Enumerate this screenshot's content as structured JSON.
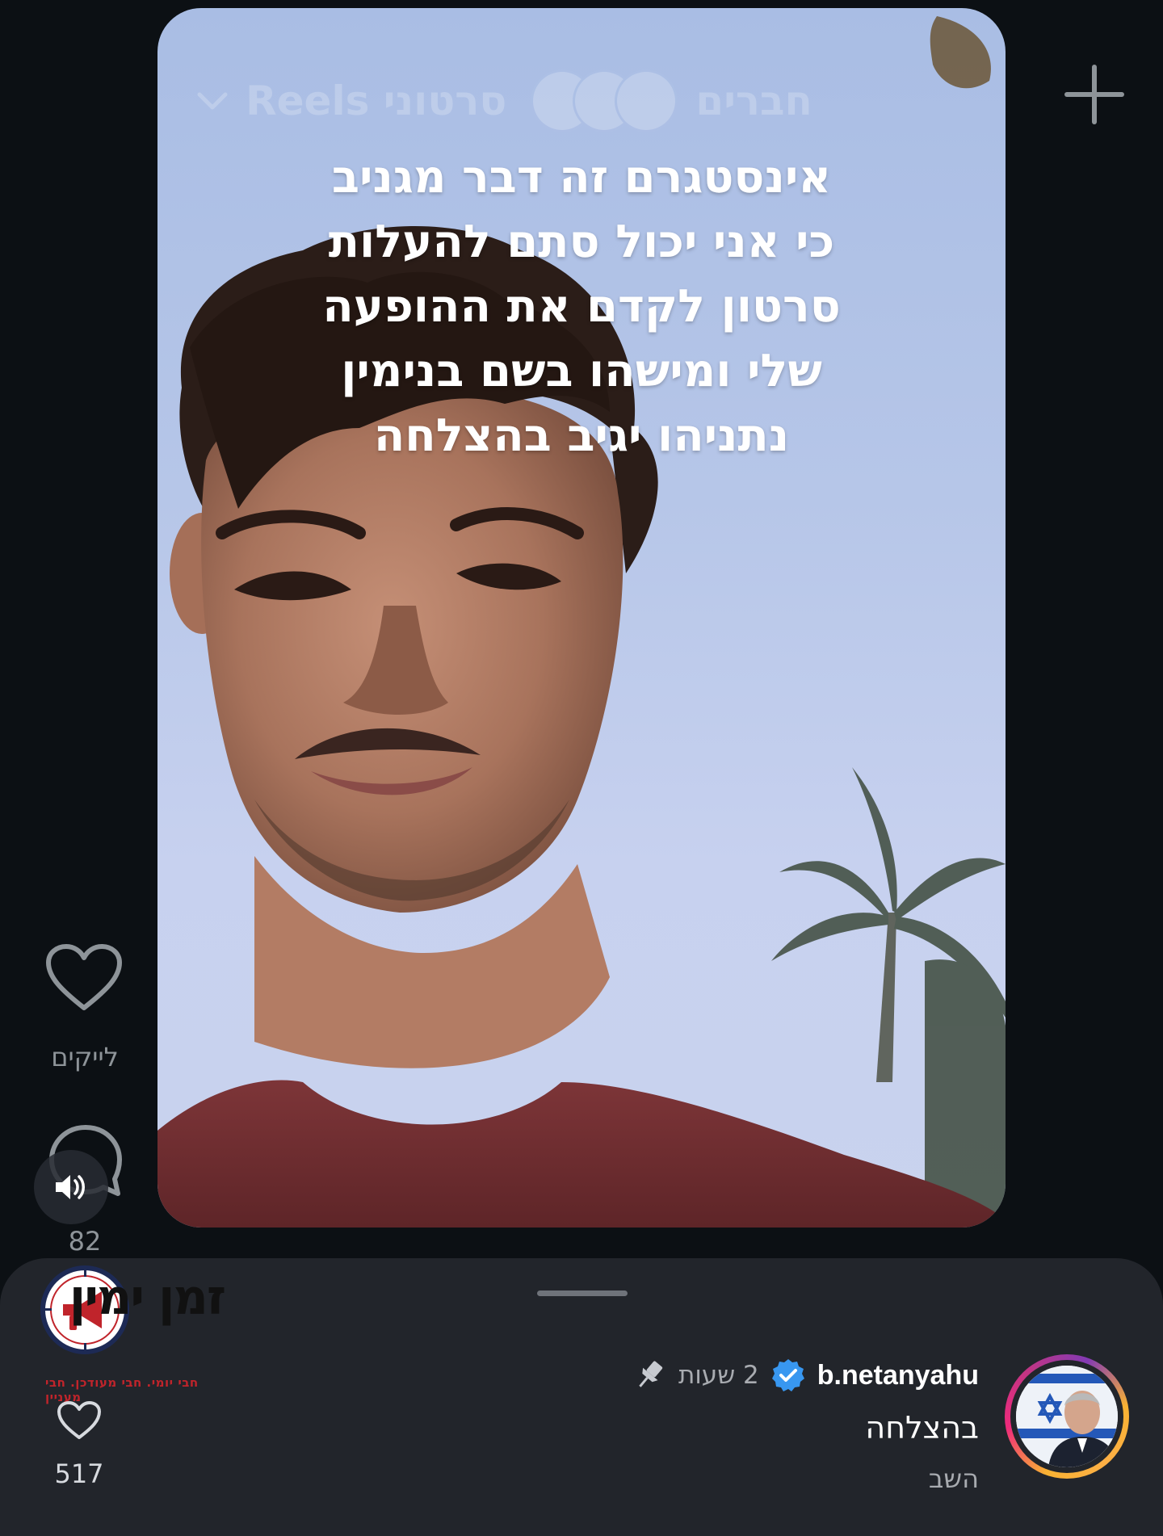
{
  "video": {
    "top_nav": {
      "reels_tab": "סרטוני Reels",
      "friends_tab": "חברים"
    },
    "caption_lines": [
      "אינסטגרם זה דבר מגניב",
      "כי אני יכול סתם להעלות",
      "סרטון לקדם את ההופעה",
      "שלי ומישהו בשם בנימין",
      "נתניהו יגיב בהצלחה"
    ]
  },
  "side_actions": {
    "likes_label": "לייקים",
    "comment_count": "82"
  },
  "logo": {
    "brand": "זמן ימין",
    "tagline": "חבי יומי. חבי מעודכן. חבי מעניין"
  },
  "comment": {
    "username": "b.netanyahu",
    "time": "2 שעות",
    "text": "בהצלחה",
    "reply_label": "השב",
    "like_count": "517"
  },
  "colors": {
    "background": "#0c1014",
    "sheet": "#22252b",
    "verified": "#3897f0",
    "logo_red": "#c0242b",
    "logo_navy": "#1d2a55"
  },
  "icons": {
    "plus": "plus-icon",
    "heart": "heart-icon",
    "comment": "comment-icon",
    "sound": "speaker-icon",
    "verified": "verified-icon",
    "pin": "pin-icon",
    "megaphone": "megaphone-icon"
  }
}
